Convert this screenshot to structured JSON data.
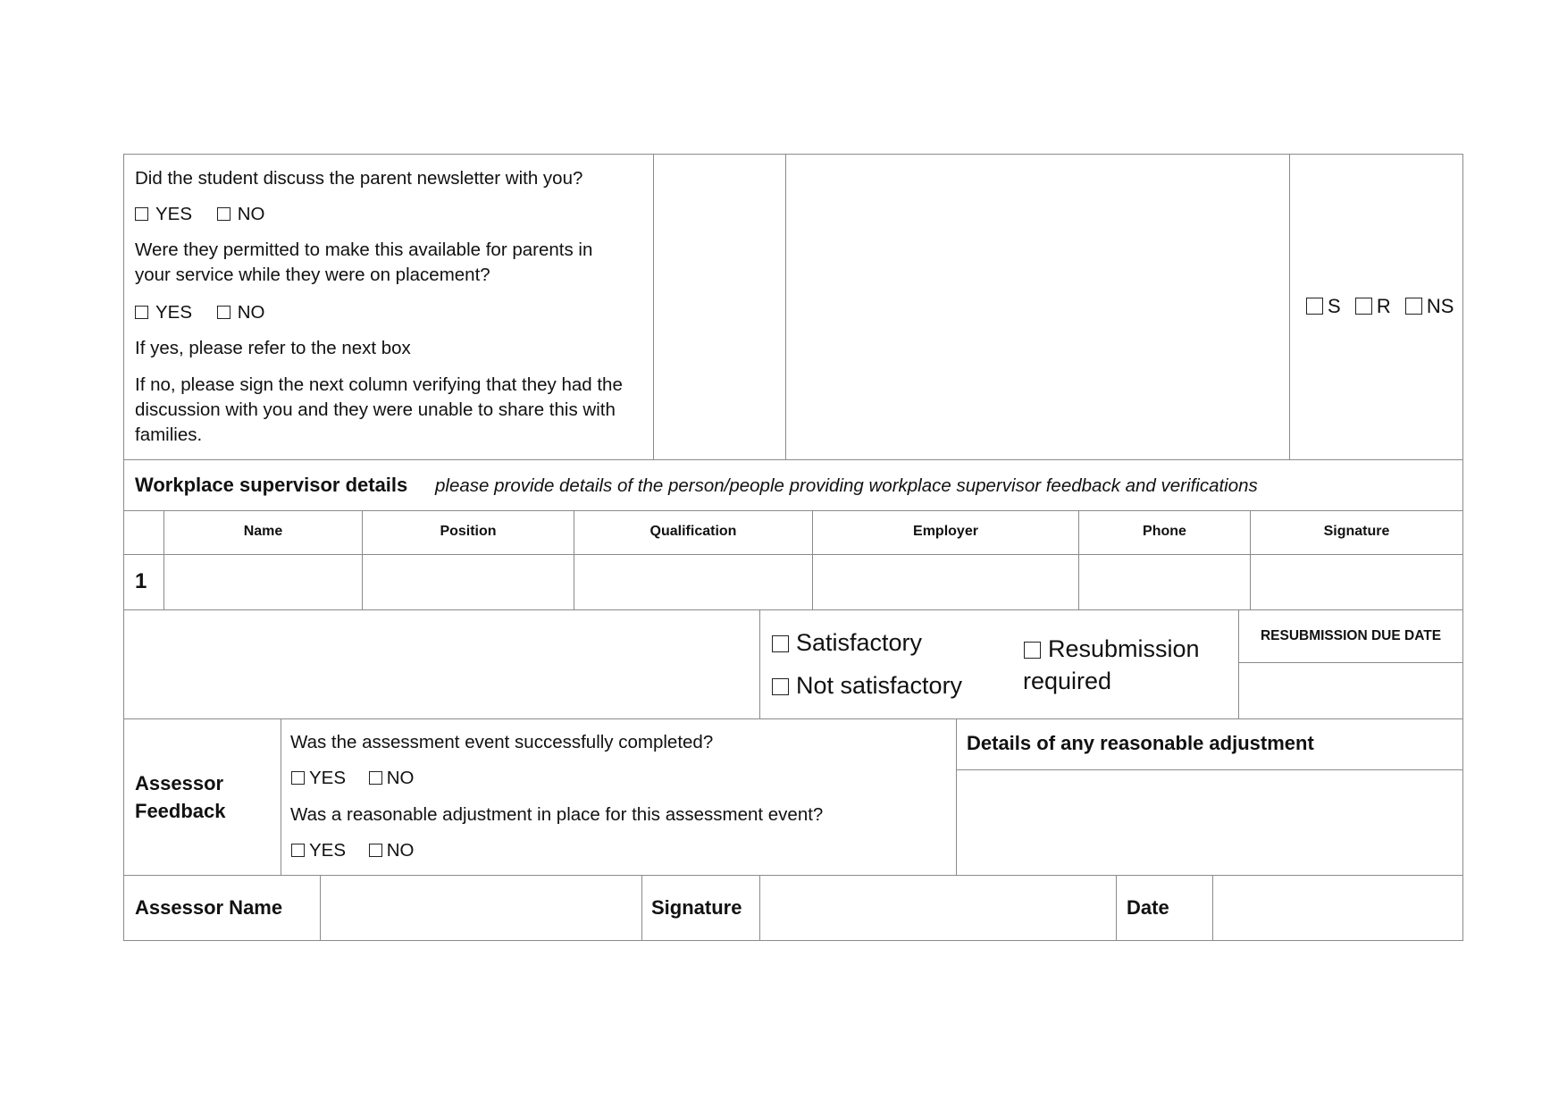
{
  "section1": {
    "q1": "Did the student discuss the parent newsletter with you?",
    "q1_options": [
      "YES",
      "NO"
    ],
    "q2_line1": "Were they permitted to make this available for parents in",
    "q2_line2": "your service while they were on placement?",
    "q2_options": [
      "YES",
      "NO"
    ],
    "note_yes": "If yes, please refer to the next box",
    "note_no_line1": "If no, please sign the next column verifying that they had the",
    "note_no_line2": "discussion with you and they were unable to share this with",
    "note_no_line3": "families.",
    "result_options": [
      "S",
      "R",
      "NS"
    ]
  },
  "supervisor": {
    "title": "Workplace supervisor details",
    "subtitle": "please provide details of the person/people providing workplace supervisor feedback and verifications",
    "columns": [
      "Name",
      "Position",
      "Qualification",
      "Employer",
      "Phone",
      "Signature"
    ],
    "rows": [
      {
        "num": "1",
        "name": "",
        "position": "",
        "qualification": "",
        "employer": "",
        "phone": "",
        "signature": ""
      }
    ]
  },
  "outcome": {
    "satisfactory": "Satisfactory",
    "not_satisfactory": "Not satisfactory",
    "resubmission_line1": "Resubmission",
    "resubmission_line2": "required",
    "due_date_label": "RESUBMISSION DUE DATE",
    "due_date_value": ""
  },
  "assessor_feedback": {
    "label_line1": "Assessor",
    "label_line2": "Feedback",
    "q1": "Was the assessment event successfully completed?",
    "q1_options": [
      "YES",
      "NO"
    ],
    "q2": "Was a reasonable adjustment in place for this assessment event?",
    "q2_options": [
      "YES",
      "NO"
    ],
    "adjustment_label": "Details of any reasonable adjustment",
    "adjustment_value": ""
  },
  "signoff": {
    "name_label": "Assessor Name",
    "signature_label": "Signature",
    "date_label": "Date",
    "name_value": "",
    "signature_value": "",
    "date_value": ""
  }
}
